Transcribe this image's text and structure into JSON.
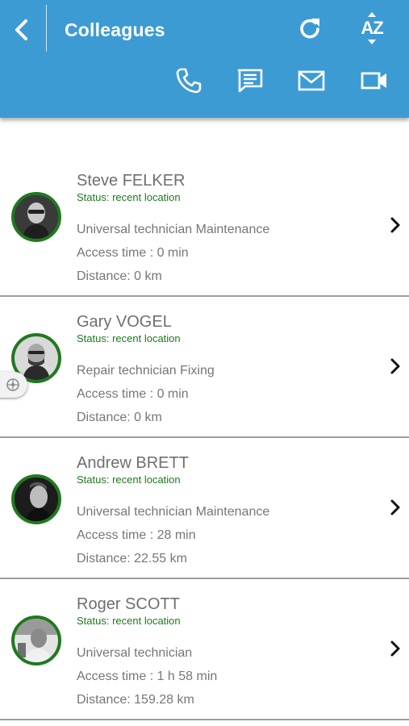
{
  "header": {
    "title": "Colleagues",
    "sort_label": "AZ",
    "accent_color": "#3d9bd4",
    "icons": [
      "back-icon",
      "refresh-icon",
      "sort-az-icon",
      "phone-icon",
      "chat-icon",
      "mail-icon",
      "video-icon"
    ]
  },
  "colleagues": [
    {
      "name": "Steve FELKER",
      "status": "Status: recent location",
      "role": "Universal technician Maintenance",
      "access": "Access time : 0 min",
      "distance": "Distance: 0 km"
    },
    {
      "name": "Gary VOGEL",
      "status": "Status: recent location",
      "role": "Repair technician Fixing",
      "access": "Access time : 0 min",
      "distance": "Distance: 0 km"
    },
    {
      "name": "Andrew BRETT",
      "status": "Status: recent location",
      "role": "Universal technician Maintenance",
      "access": "Access time : 28 min",
      "distance": "Distance: 22.55 km"
    },
    {
      "name": "Roger SCOTT",
      "status": "Status: recent location",
      "role": "Universal technician",
      "access": "Access time : 1 h 58 min",
      "distance": "Distance: 159.28 km"
    }
  ],
  "status_color": "#1c7a1c"
}
